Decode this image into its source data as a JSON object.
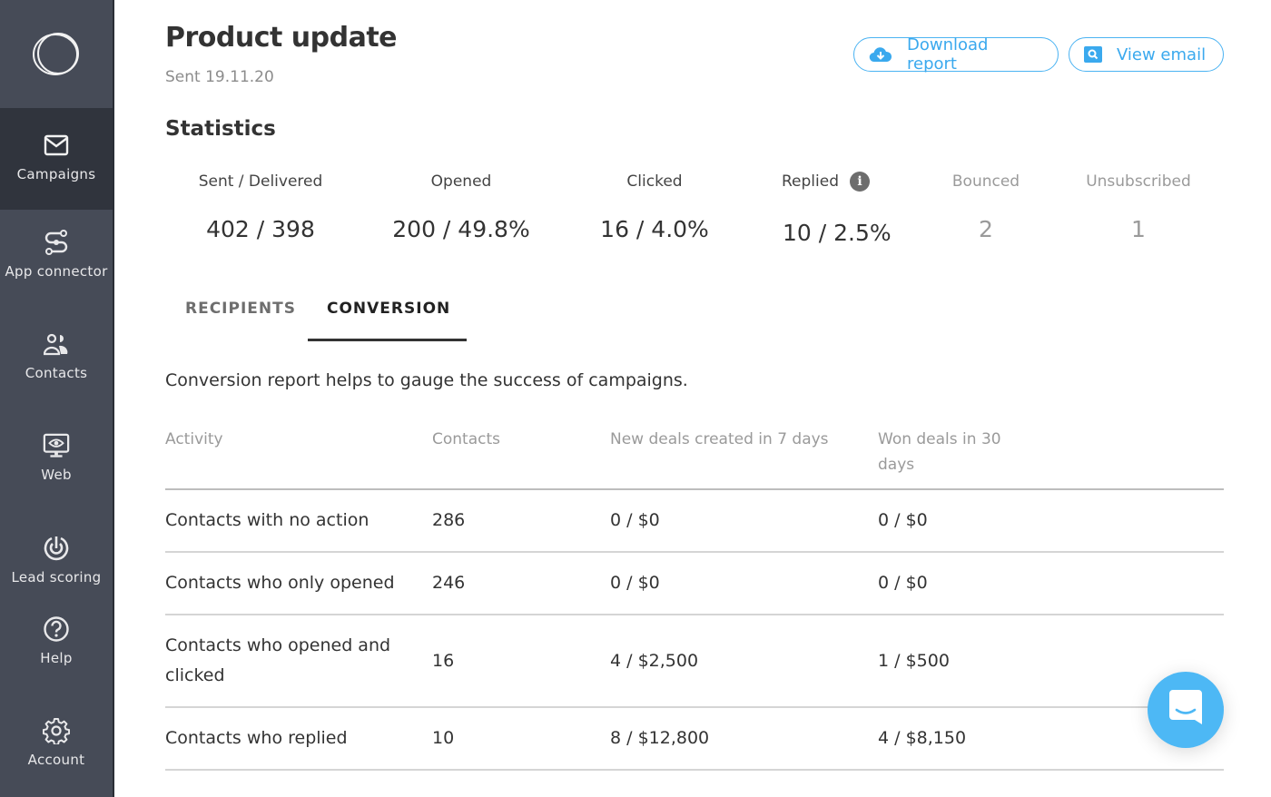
{
  "sidebar": {
    "logo": "double-circle-logo",
    "items": [
      {
        "label": "Campaigns",
        "icon": "envelope-icon",
        "active": true
      },
      {
        "label": "App connector",
        "icon": "connector-icon",
        "active": false
      },
      {
        "label": "Contacts",
        "icon": "contacts-icon",
        "active": false
      },
      {
        "label": "Web",
        "icon": "monitor-eye-icon",
        "active": false
      },
      {
        "label": "Lead scoring",
        "icon": "target-icon",
        "active": false
      },
      {
        "label": "Help",
        "icon": "question-circle-icon",
        "active": false
      },
      {
        "label": "Account",
        "icon": "gear-icon",
        "active": false
      }
    ]
  },
  "header": {
    "title": "Product update",
    "subtitle": "Sent 19.11.20",
    "download_label": "Download report",
    "view_email_label": "View email"
  },
  "statistics": {
    "title": "Statistics",
    "items": [
      {
        "label": "Sent / Delivered",
        "value": "402 / 398"
      },
      {
        "label": "Opened",
        "value": "200 / 49.8%"
      },
      {
        "label": "Clicked",
        "value": "16 / 4.0%"
      },
      {
        "label": "Replied",
        "value": "10 / 2.5%",
        "info": "i"
      },
      {
        "label": "Bounced",
        "value": "2"
      },
      {
        "label": "Unsubscribed",
        "value": "1"
      }
    ]
  },
  "tabs": [
    {
      "label": "RECIPIENTS",
      "active": false
    },
    {
      "label": "CONVERSION",
      "active": true
    }
  ],
  "conversion": {
    "description": "Conversion report helps to gauge the success of campaigns.",
    "columns": [
      "Activity",
      "Contacts",
      "New deals created in 7 days",
      "Won deals in 30 days"
    ],
    "rows": [
      {
        "activity": "Contacts with no action",
        "contacts": "286",
        "new_deals": "0 / $0",
        "won_deals": "0 / $0"
      },
      {
        "activity": "Contacts who only opened",
        "contacts": "246",
        "new_deals": "0 / $0",
        "won_deals": "0 / $0"
      },
      {
        "activity": "Contacts who opened and clicked",
        "contacts": "16",
        "new_deals": "4 / $2,500",
        "won_deals": "1 / $500"
      },
      {
        "activity": "Contacts who replied",
        "contacts": "10",
        "new_deals": "8 / $12,800",
        "won_deals": "4 / $8,150"
      }
    ]
  },
  "colors": {
    "accent": "#4db8f5",
    "sidebar_bg": "#464b57",
    "sidebar_active": "#30343d"
  }
}
